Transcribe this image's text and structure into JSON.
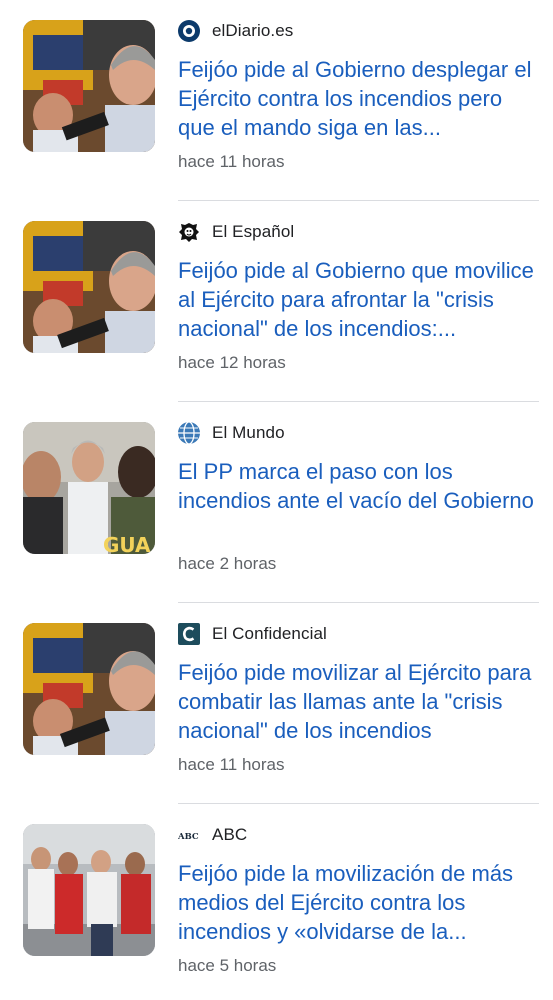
{
  "articles": [
    {
      "source": "elDiario.es",
      "source_icon": "eldiario-logo-icon",
      "headline": "Feijóo pide al Gobierno desplegar el Ejército contra los incendios pero que el mando siga en las...",
      "time": "hace 11 horas",
      "thumbnail": "feijoo-press-thumbnail"
    },
    {
      "source": "El Español",
      "source_icon": "elespanol-lion-logo-icon",
      "headline": "Feijóo pide al Gobierno que movilice al Ejército para afrontar la \"crisis nacional\" de los incendios:...",
      "time": "hace 12 horas",
      "thumbnail": "feijoo-press-thumbnail"
    },
    {
      "source": "El Mundo",
      "source_icon": "elmundo-globe-logo-icon",
      "headline": "El PP marca el paso con los incendios ante el vacío del Gobierno",
      "time": "hace 2 horas",
      "thumbnail": "feijoo-guardia-civil-thumbnail"
    },
    {
      "source": "El Confidencial",
      "source_icon": "elconfidencial-logo-icon",
      "headline": "Feijóo pide movilizar al Ejército para combatir las llamas ante la \"crisis nacional\" de los incendios",
      "time": "hace 11 horas",
      "thumbnail": "feijoo-press-thumbnail"
    },
    {
      "source": "ABC",
      "source_icon": "abc-logo-icon",
      "source_logo_text": "ABC",
      "headline": "Feijóo pide la movilización de más medios del Ejército contra los incendios y «olvidarse de la...",
      "time": "hace 5 horas",
      "thumbnail": "feijoo-visit-thumbnail"
    }
  ],
  "colors": {
    "headline": "#1a5ebd",
    "source": "#202124",
    "time": "#5f6368",
    "divider": "#dadce0"
  },
  "thumbnail_photo_text": "GUA"
}
